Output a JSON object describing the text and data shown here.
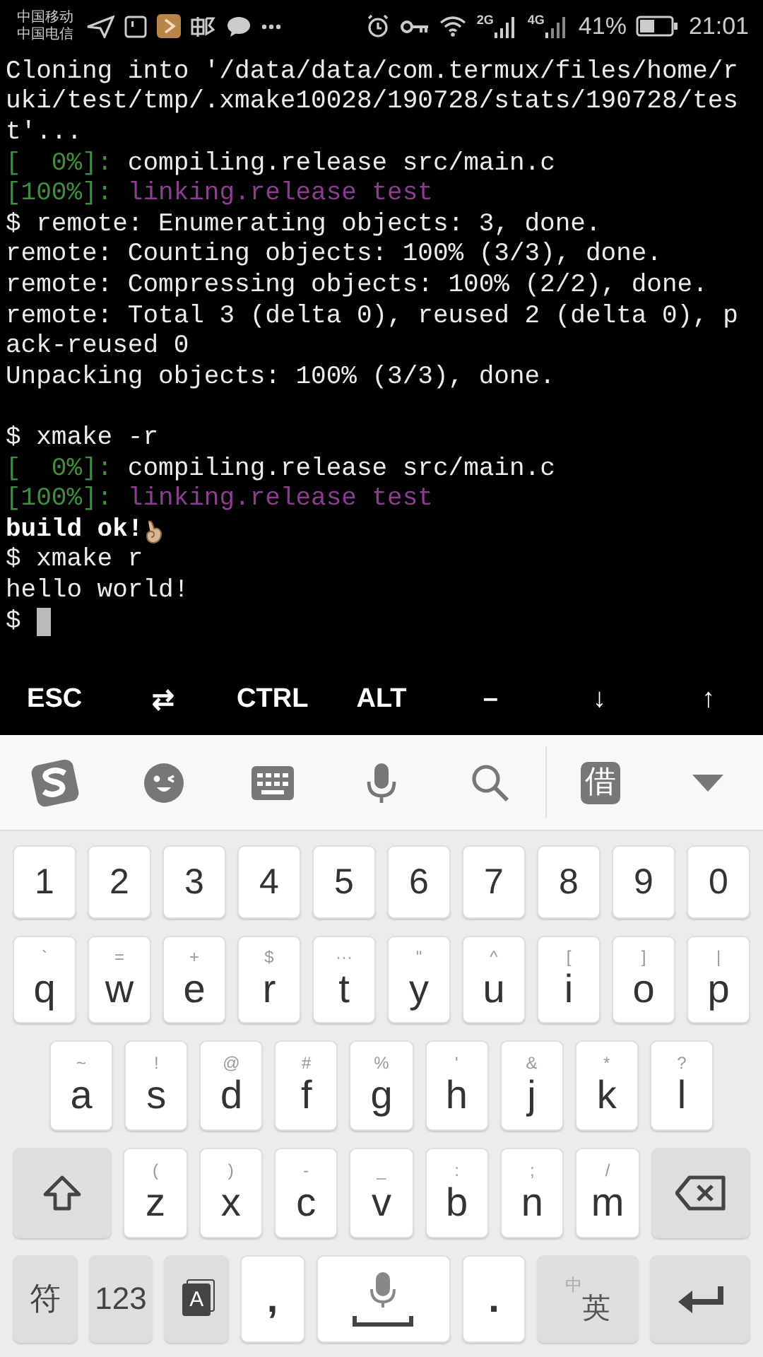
{
  "status_bar": {
    "carriers": [
      "中国移动",
      "中国电信"
    ],
    "network_labels": [
      "2G",
      "4G"
    ],
    "battery": "41%",
    "time": "21:01"
  },
  "terminal": {
    "lines": [
      {
        "segments": [
          {
            "text": "Cloning into '/data/data/com.termux/files/home/r",
            "color": "#ececec"
          }
        ]
      },
      {
        "segments": [
          {
            "text": "uki/test/tmp/.xmake10028/190728/stats/190728/tes",
            "color": "#ececec"
          }
        ]
      },
      {
        "segments": [
          {
            "text": "t'...",
            "color": "#ececec"
          }
        ]
      },
      {
        "segments": [
          {
            "text": "[  0%]:",
            "color": "#3f8f3f"
          },
          {
            "text": " compiling.release src/main.c",
            "color": "#ececec"
          }
        ]
      },
      {
        "segments": [
          {
            "text": "[100%]:",
            "color": "#3f8f3f"
          },
          {
            "text": " linking.release test",
            "color": "#8e3d92"
          }
        ]
      },
      {
        "segments": [
          {
            "text": "$ remote: Enumerating objects: 3, done.",
            "color": "#ececec"
          }
        ]
      },
      {
        "segments": [
          {
            "text": "remote: Counting objects: 100% (3/3), done.",
            "color": "#ececec"
          }
        ]
      },
      {
        "segments": [
          {
            "text": "remote: Compressing objects: 100% (2/2), done.",
            "color": "#ececec"
          }
        ]
      },
      {
        "segments": [
          {
            "text": "remote: Total 3 (delta 0), reused 2 (delta 0), p",
            "color": "#ececec"
          }
        ]
      },
      {
        "segments": [
          {
            "text": "ack-reused 0",
            "color": "#ececec"
          }
        ]
      },
      {
        "segments": [
          {
            "text": "Unpacking objects: 100% (3/3), done.",
            "color": "#ececec"
          }
        ]
      },
      {
        "gap_before": true,
        "segments": [
          {
            "text": "$ xmake -r",
            "color": "#ececec"
          }
        ]
      },
      {
        "segments": [
          {
            "text": "[  0%]:",
            "color": "#3f8f3f"
          },
          {
            "text": " compiling.release src/main.c",
            "color": "#ececec"
          }
        ]
      },
      {
        "segments": [
          {
            "text": "[100%]:",
            "color": "#3f8f3f"
          },
          {
            "text": " linking.release test",
            "color": "#8e3d92"
          }
        ]
      },
      {
        "ok_hand": true,
        "segments": [
          {
            "text": "build ok!",
            "color": "#ffffff",
            "bold": true
          }
        ]
      },
      {
        "segments": [
          {
            "text": "$ xmake r",
            "color": "#ececec"
          }
        ]
      },
      {
        "segments": [
          {
            "text": "hello world!",
            "color": "#ececec"
          }
        ]
      },
      {
        "cursor": true,
        "segments": [
          {
            "text": "$ ",
            "color": "#ececec"
          }
        ]
      }
    ]
  },
  "extra_keys": [
    {
      "label": "ESC"
    },
    {
      "label": "⇄"
    },
    {
      "label": "CTRL"
    },
    {
      "label": "ALT"
    },
    {
      "label": "–"
    },
    {
      "label": "↓"
    },
    {
      "label": "↑"
    }
  ],
  "keyboard_toolbar": [
    {
      "kind": "logo"
    },
    {
      "kind": "emoji"
    },
    {
      "kind": "keyboard"
    },
    {
      "kind": "mic"
    },
    {
      "kind": "search"
    },
    {
      "kind": "char",
      "label": "借"
    },
    {
      "kind": "collapse"
    }
  ],
  "keyboard_rows": [
    [
      {
        "kind": "char",
        "label": "1"
      },
      {
        "kind": "char",
        "label": "2"
      },
      {
        "kind": "char",
        "label": "3"
      },
      {
        "kind": "char",
        "label": "4"
      },
      {
        "kind": "char",
        "label": "5"
      },
      {
        "kind": "char",
        "label": "6"
      },
      {
        "kind": "char",
        "label": "7"
      },
      {
        "kind": "char",
        "label": "8"
      },
      {
        "kind": "char",
        "label": "9"
      },
      {
        "kind": "char",
        "label": "0"
      }
    ],
    [
      {
        "kind": "char",
        "label": "q",
        "hint": "`"
      },
      {
        "kind": "char",
        "label": "w",
        "hint": "="
      },
      {
        "kind": "char",
        "label": "e",
        "hint": "+"
      },
      {
        "kind": "char",
        "label": "r",
        "hint": "$"
      },
      {
        "kind": "char",
        "label": "t",
        "hint": "···"
      },
      {
        "kind": "char",
        "label": "y",
        "hint": "\""
      },
      {
        "kind": "char",
        "label": "u",
        "hint": "^"
      },
      {
        "kind": "char",
        "label": "i",
        "hint": "["
      },
      {
        "kind": "char",
        "label": "o",
        "hint": "]"
      },
      {
        "kind": "char",
        "label": "p",
        "hint": "|"
      }
    ],
    [
      {
        "kind": "char",
        "label": "a",
        "hint": "~"
      },
      {
        "kind": "char",
        "label": "s",
        "hint": "!"
      },
      {
        "kind": "char",
        "label": "d",
        "hint": "@"
      },
      {
        "kind": "char",
        "label": "f",
        "hint": "#"
      },
      {
        "kind": "char",
        "label": "g",
        "hint": "%"
      },
      {
        "kind": "char",
        "label": "h",
        "hint": "'"
      },
      {
        "kind": "char",
        "label": "j",
        "hint": "&"
      },
      {
        "kind": "char",
        "label": "k",
        "hint": "*"
      },
      {
        "kind": "char",
        "label": "l",
        "hint": "?"
      }
    ],
    [
      {
        "kind": "shift"
      },
      {
        "kind": "char",
        "label": "z",
        "hint": "("
      },
      {
        "kind": "char",
        "label": "x",
        "hint": ")"
      },
      {
        "kind": "char",
        "label": "c",
        "hint": "-"
      },
      {
        "kind": "char",
        "label": "v",
        "hint": "_"
      },
      {
        "kind": "char",
        "label": "b",
        "hint": ":"
      },
      {
        "kind": "char",
        "label": "n",
        "hint": ";"
      },
      {
        "kind": "char",
        "label": "m",
        "hint": "/"
      },
      {
        "kind": "backspace"
      }
    ],
    [
      {
        "kind": "func",
        "label": "符"
      },
      {
        "kind": "func",
        "label": "123"
      },
      {
        "kind": "mode",
        "label": "A"
      },
      {
        "kind": "punct",
        "label": ","
      },
      {
        "kind": "space"
      },
      {
        "kind": "punct",
        "label": "."
      },
      {
        "kind": "lang",
        "label": "英",
        "hint": "中"
      },
      {
        "kind": "enter"
      }
    ]
  ]
}
